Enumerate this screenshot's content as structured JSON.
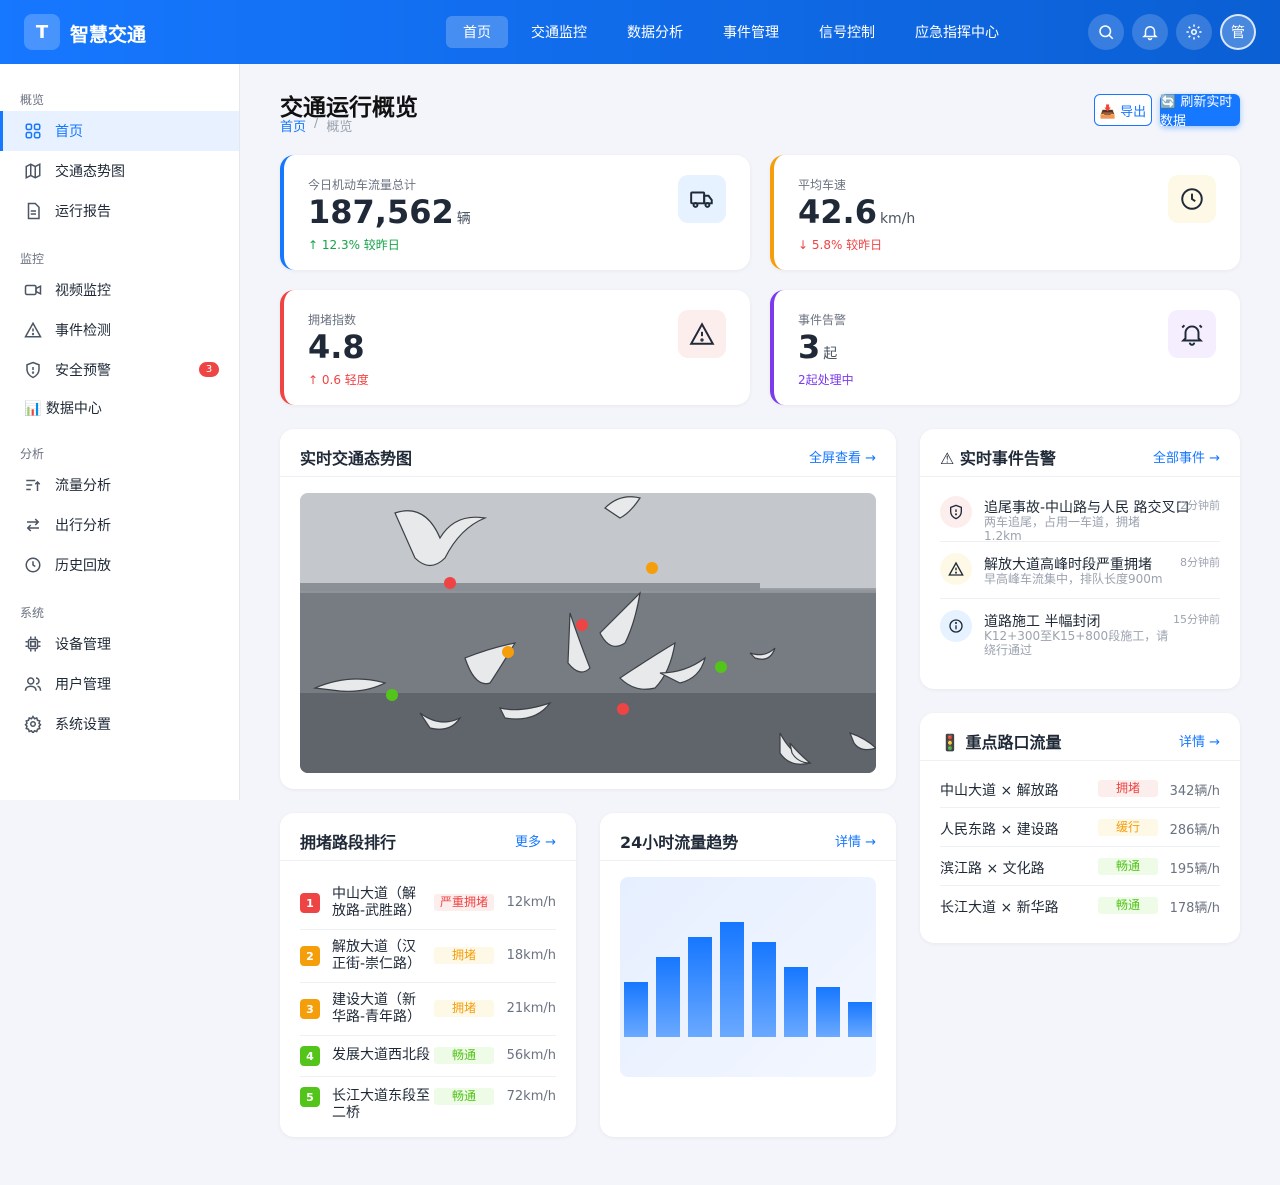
{
  "header": {
    "logo_letter": "T",
    "brand": "智慧交通",
    "tabs": [
      "首页",
      "交通监控",
      "数据分析",
      "事件管理",
      "信号控制",
      "应急指挥中心"
    ],
    "avatar": "管"
  },
  "sidebar": {
    "sections": [
      "概览",
      "监控",
      "分析",
      "系统"
    ],
    "items": [
      {
        "label": "首页",
        "icon": "grid-icon"
      },
      {
        "label": "交通态势图",
        "icon": "map-icon"
      },
      {
        "label": "运行报告",
        "icon": "document-icon"
      },
      {
        "label": "视频监控",
        "icon": "video-icon"
      },
      {
        "label": "事件检测",
        "icon": "warning-icon"
      },
      {
        "label": "安全预警",
        "icon": "shield-icon",
        "badge": "3"
      },
      {
        "label": "📊 数据中心",
        "icon": ""
      },
      {
        "label": "流量分析",
        "icon": "sort-ascending-icon"
      },
      {
        "label": "出行分析",
        "icon": "swap-icon"
      },
      {
        "label": "历史回放",
        "icon": "clock-icon"
      },
      {
        "label": "设备管理",
        "icon": "chip-icon"
      },
      {
        "label": "用户管理",
        "icon": "users-icon"
      },
      {
        "label": "系统设置",
        "icon": "gear-icon"
      }
    ]
  },
  "page": {
    "title": "交通运行概览",
    "breadcrumb": [
      "首页",
      "概览"
    ],
    "export_label": "📥 导出",
    "refresh_label": "🔄 刷新实时数据"
  },
  "stats": [
    {
      "label": "今日机动车流量总计",
      "value": "187,562",
      "unit": "辆",
      "change": "↑ 12.3% 较昨日",
      "change_color": "#16a34a",
      "accent": "#1677ff",
      "icon": "truck-icon",
      "icon_bg": "#e6f2ff"
    },
    {
      "label": "平均车速",
      "value": "42.6",
      "unit": "km/h",
      "change": "↓ 5.8% 较昨日",
      "change_color": "#ef4444",
      "accent": "#f59e0b",
      "icon": "clock-icon",
      "icon_bg": "#fef9e7"
    },
    {
      "label": "拥堵指数",
      "value": "4.8",
      "unit": "",
      "change": "↑ 0.6 轻度",
      "change_color": "#ef4444",
      "accent": "#ef4444",
      "icon": "warning-icon",
      "icon_bg": "#fdeeee"
    },
    {
      "label": "事件告警",
      "value": "3",
      "unit": "起",
      "change": "2起处理中",
      "change_color": "#7c3aed",
      "accent": "#7c3aed",
      "icon": "bell-icon",
      "icon_bg": "#f4eefe"
    }
  ],
  "map_card": {
    "title": "实时交通态势图",
    "link": "全屏查看 →",
    "markers": [
      {
        "status": "congested",
        "color": "#ef4444"
      },
      {
        "status": "slow",
        "color": "#f59e0b"
      },
      {
        "status": "congested",
        "color": "#ef4444"
      },
      {
        "status": "slow",
        "color": "#f59e0b"
      },
      {
        "status": "smooth",
        "color": "#52c41a"
      },
      {
        "status": "smooth",
        "color": "#52c41a"
      },
      {
        "status": "congested",
        "color": "#ef4444"
      }
    ]
  },
  "alerts_card": {
    "title": "⚠ 实时事件告警",
    "link": "全部事件 →",
    "items": [
      {
        "title": "追尾事故-中山路与人民 路交叉口",
        "desc": "两车追尾，占用一车道，拥堵1.2km",
        "time": "2分钟前",
        "icon": "shield-icon",
        "color": "#ef4444",
        "bg": "#fdeeee"
      },
      {
        "title": "解放大道高峰时段严重拥堵",
        "desc": "早高峰车流集中，排队长度900m",
        "time": "8分钟前",
        "icon": "warning-icon",
        "color": "#f59e0b",
        "bg": "#fef9e7"
      },
      {
        "title": "道路施工 半幅封闭",
        "desc": "K12+300至K15+800段施工，请绕行通过",
        "time": "15分钟前",
        "icon": "info-icon",
        "color": "#1677ff",
        "bg": "#e6f2ff"
      }
    ]
  },
  "junctions_card": {
    "title": "🚦 重点路口流量",
    "link": "详情 →",
    "rows": [
      {
        "name": "中山大道 × 解放路",
        "tag": "拥堵",
        "value": "342辆/h",
        "color": "#ef4444",
        "bg": "#fdeeee"
      },
      {
        "name": "人民东路 × 建设路",
        "tag": "缓行",
        "value": "286辆/h",
        "color": "#f59e0b",
        "bg": "#fef9e7"
      },
      {
        "name": "滨江路 × 文化路",
        "tag": "畅通",
        "value": "195辆/h",
        "color": "#52c41a",
        "bg": "#eefbe7"
      },
      {
        "name": "长江大道 × 新华路",
        "tag": "畅通",
        "value": "178辆/h",
        "color": "#52c41a",
        "bg": "#eefbe7"
      }
    ]
  },
  "ranking_card": {
    "title": "拥堵路段排行",
    "link": "更多 →",
    "rows": [
      {
        "rank": "1",
        "name": "中山大道（解放路-武胜路）",
        "tag": "严重拥堵",
        "speed": "12km/h",
        "color": "#ef4444",
        "bg": "#fdeeee"
      },
      {
        "name": "解放大道（汉正街-崇仁路）",
        "rank": "2",
        "tag": "拥堵",
        "speed": "18km/h",
        "color": "#f59e0b",
        "bg": "#fef9e7"
      },
      {
        "rank": "3",
        "name": "建设大道（新华路-青年路）",
        "tag": "拥堵",
        "speed": "21km/h",
        "color": "#f59e0b",
        "bg": "#fef9e7"
      },
      {
        "rank": "4",
        "name": "发展大道西北段",
        "tag": "畅通",
        "speed": "56km/h",
        "color": "#52c41a",
        "bg": "#eefbe7"
      },
      {
        "rank": "5",
        "name": "长江大道东段至二桥",
        "tag": "畅通",
        "speed": "72km/h",
        "color": "#52c41a",
        "bg": "#eefbe7"
      }
    ]
  },
  "trend_card": {
    "title": "24小时流量趋势",
    "link": "详情 →"
  },
  "chart_data": {
    "type": "bar",
    "categories": [
      "",
      "",
      "",
      "",
      "",
      "",
      "",
      ""
    ],
    "values": [
      55,
      80,
      100,
      115,
      95,
      70,
      50,
      35
    ],
    "ylim": [
      0,
      160
    ],
    "bar_color": "#1677ff"
  }
}
